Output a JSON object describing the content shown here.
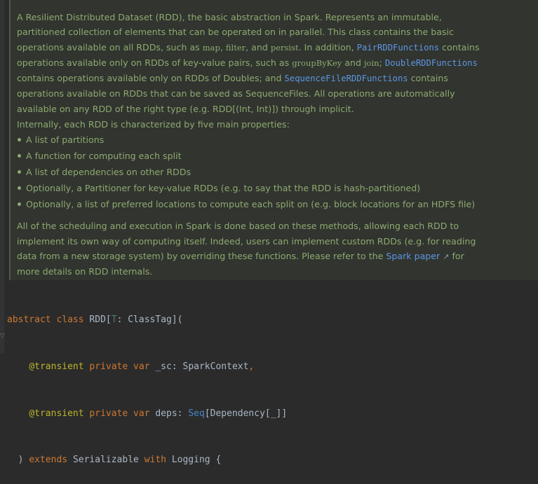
{
  "doc": {
    "p1": {
      "t1": "A Resilient Distributed Dataset (RDD), the basic abstraction in Spark. Represents an immutable, partitioned collection of elements that can be operated on in parallel. This class contains the basic operations available on all RDDs, such as ",
      "c_map": "map",
      "t2": ", ",
      "c_filter": "filter",
      "t3": ", and ",
      "c_persist": "persist",
      "t4": ". In addition, ",
      "link_pair": "PairRDDFunctions",
      "t5": " contains operations available only on RDDs of key-value pairs, such as ",
      "c_groupbykey": "groupByKey",
      "t6": " and ",
      "c_join": "join",
      "t7": "; ",
      "link_double": "DoubleRDDFunctions",
      "t8": " contains operations available only on RDDs of Doubles; and ",
      "link_seqfile": "SequenceFileRDDFunctions",
      "t9": " contains operations available on RDDs that can be saved as SequenceFiles. All operations are automatically available on any RDD of the right type (e.g. RDD[(Int, Int)]) through implicit."
    },
    "p2": "Internally, each RDD is characterized by five main properties:",
    "list": [
      "A list of partitions",
      "A function for computing each split",
      "A list of dependencies on other RDDs",
      "Optionally, a Partitioner for key-value RDDs (e.g. to say that the RDD is hash-partitioned)",
      "Optionally, a list of preferred locations to compute each split on (e.g. block locations for an HDFS file)"
    ],
    "p3": {
      "t1": "All of the scheduling and execution in Spark is done based on these methods, allowing each RDD to implement its own way of computing itself. Indeed, users can implement custom RDDs (e.g. for reading data from a new storage system) by overriding these functions. Please refer to the ",
      "link": "Spark paper",
      "arrow": "↗",
      "t2": " for more details on RDD internals."
    }
  },
  "code": {
    "l1": {
      "kw1": "abstract",
      "kw2": "class",
      "name": "RDD",
      "open": "[",
      "tparam": "T",
      "colon": ": ",
      "bound": "ClassTag",
      "close": "](",
      "indent": " "
    },
    "l2": {
      "ann": "@transient",
      "kw1": "private",
      "kw2": "var",
      "name": "_sc",
      "colon": ": ",
      "type": "SparkContext",
      "comma": ","
    },
    "l3": {
      "ann": "@transient",
      "kw1": "private",
      "kw2": "var",
      "name": "deps",
      "colon": ": ",
      "type": "Seq",
      "rest": "[Dependency[_]]"
    },
    "l4": {
      "close": ") ",
      "kw1": "extends",
      "type1": "Serializable",
      "kw2": "with",
      "type2": "Logging",
      "brace": " {"
    }
  }
}
